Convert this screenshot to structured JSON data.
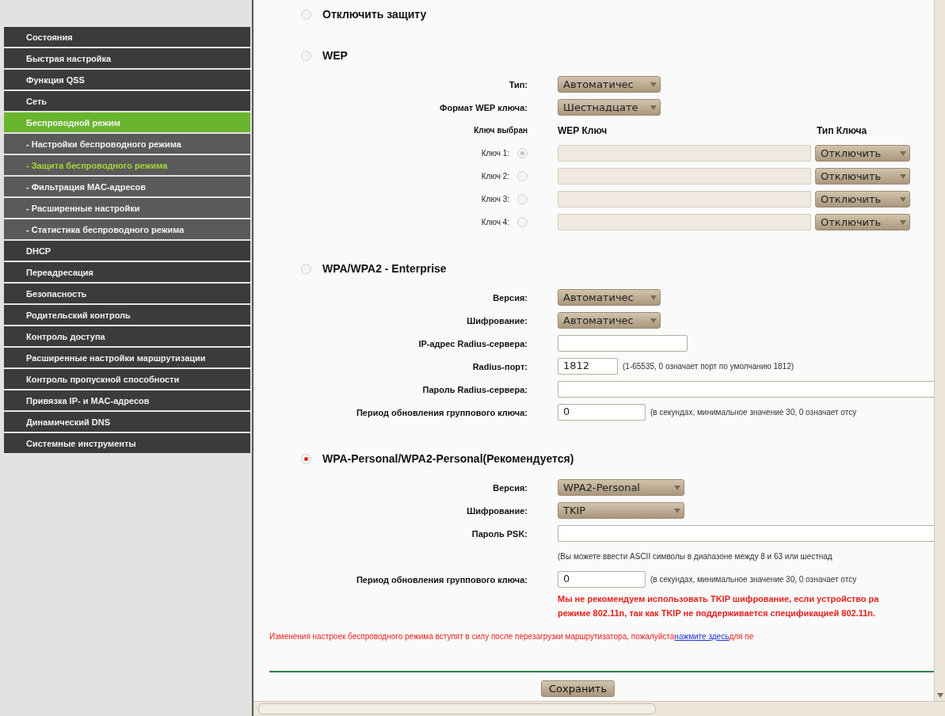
{
  "sidebar": {
    "items": [
      {
        "label": "Состояния",
        "kind": "main",
        "selected": false
      },
      {
        "label": "Быстрая настройка",
        "kind": "main",
        "selected": false
      },
      {
        "label": "Функция QSS",
        "kind": "main",
        "selected": false
      },
      {
        "label": "Сеть",
        "kind": "main",
        "selected": false
      },
      {
        "label": "Беспроводной режим",
        "kind": "main",
        "selected": true
      },
      {
        "label": "- Настройки беспроводного режима",
        "kind": "sub",
        "selected": false
      },
      {
        "label": "- Защита беспроводного режима",
        "kind": "sub",
        "selected": true
      },
      {
        "label": "- Фильтрация MAC-адресов",
        "kind": "sub",
        "selected": false
      },
      {
        "label": "- Расширенные настройки",
        "kind": "sub",
        "selected": false
      },
      {
        "label": "- Статистика беспроводного режима",
        "kind": "sub",
        "selected": false
      },
      {
        "label": "DHCP",
        "kind": "main",
        "selected": false
      },
      {
        "label": "Переадресация",
        "kind": "main",
        "selected": false
      },
      {
        "label": "Безопасность",
        "kind": "main",
        "selected": false
      },
      {
        "label": "Родительский контроль",
        "kind": "main",
        "selected": false
      },
      {
        "label": "Контроль доступа",
        "kind": "main",
        "selected": false
      },
      {
        "label": "Расширенные настройки маршрутизации",
        "kind": "main",
        "selected": false
      },
      {
        "label": "Контроль пропускной способности",
        "kind": "main",
        "selected": false
      },
      {
        "label": "Привязка IP- и MAC-адресов",
        "kind": "main",
        "selected": false
      },
      {
        "label": "Динамический DNS",
        "kind": "main",
        "selected": false
      },
      {
        "label": "Системные инструменты",
        "kind": "main",
        "selected": false
      }
    ]
  },
  "security_modes": [
    {
      "title": "Отключить защиту",
      "selected": false
    },
    {
      "title": "WEP",
      "selected": false,
      "rows": [
        {
          "kind": "select",
          "label": "Тип:",
          "value": "Автоматичес"
        },
        {
          "kind": "select",
          "label": "Формат WEP ключа:",
          "value": "Шестнадцате"
        },
        {
          "kind": "key_table",
          "headers": [
            "Ключ выбран",
            "WEP Ключ",
            "Тип Ключа"
          ],
          "keys": [
            {
              "label": "Ключ 1:",
              "selected": true,
              "type": "Отключить"
            },
            {
              "label": "Ключ 2:",
              "selected": false,
              "type": "Отключить"
            },
            {
              "label": "Ключ 3:",
              "selected": false,
              "type": "Отключить"
            },
            {
              "label": "Ключ 4:",
              "selected": false,
              "type": "Отключить"
            }
          ]
        }
      ]
    },
    {
      "title": "WPA/WPA2 - Enterprise",
      "selected": false,
      "rows": [
        {
          "kind": "select",
          "label": "Версия:",
          "value": "Автоматичес"
        },
        {
          "kind": "select",
          "label": "Шифрование:",
          "value": "Автоматичес"
        },
        {
          "kind": "input",
          "label": "IP-адрес Radius-сервера:"
        },
        {
          "kind": "input",
          "label": "Radius-порт:",
          "value": "1812",
          "hint": "(1-65535, 0 означает порт по умолчанию 1812)"
        },
        {
          "kind": "input",
          "label": "Пароль Radius-сервера:"
        },
        {
          "kind": "input",
          "label": "Период обновления группового ключа:",
          "value": "0",
          "hint": "(в секундах, минимальное значение 30, 0 означает отсу"
        }
      ]
    },
    {
      "title": "WPA-Personal/WPA2-Personal(Рекомендуется)",
      "selected": true,
      "rows": [
        {
          "kind": "select",
          "label": "Версия:",
          "value": "WPA2-Personal"
        },
        {
          "kind": "select",
          "label": "Шифрование:",
          "value": "TKIP"
        },
        {
          "kind": "input",
          "label": "Пароль PSK:"
        },
        {
          "kind": "note",
          "text": "(Вы можете ввести ASCII символы в диапазоне между 8 и 63 или шестнад"
        },
        {
          "kind": "input",
          "label": "Период обновления группового ключа:",
          "value": "0",
          "hint": "(в секундах, минимальное значение 30, 0 означает отсу"
        },
        {
          "kind": "warning",
          "lines": [
            "Мы не рекомендуем использовать TKIP шифрование, если устройство ра",
            "режиме 802.11n, так как TKIP не поддерживается спецификацией 802.11n."
          ]
        }
      ]
    }
  ],
  "notice": {
    "before": "Изменения настроек беспроводного режима вступят в силу после перезагрузки маршрутизатора, пожалуйста",
    "link": "нажмите здесь",
    "after": "для пе"
  },
  "save_button": "Сохранить"
}
